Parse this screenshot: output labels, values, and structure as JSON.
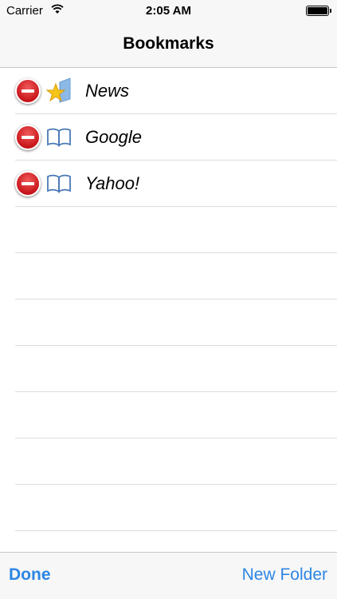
{
  "status_bar": {
    "carrier": "Carrier",
    "time": "2:05 AM",
    "wifi_icon": "wifi-icon",
    "battery_icon": "battery-icon"
  },
  "nav": {
    "title": "Bookmarks"
  },
  "bookmarks": [
    {
      "label": "News",
      "icon": "starred-folder-icon"
    },
    {
      "label": "Google",
      "icon": "bookmark-book-icon"
    },
    {
      "label": "Yahoo!",
      "icon": "bookmark-book-icon"
    }
  ],
  "toolbar": {
    "done_label": "Done",
    "new_folder_label": "New Folder"
  },
  "colors": {
    "accent": "#2d86e4",
    "delete": "#c8151b"
  }
}
